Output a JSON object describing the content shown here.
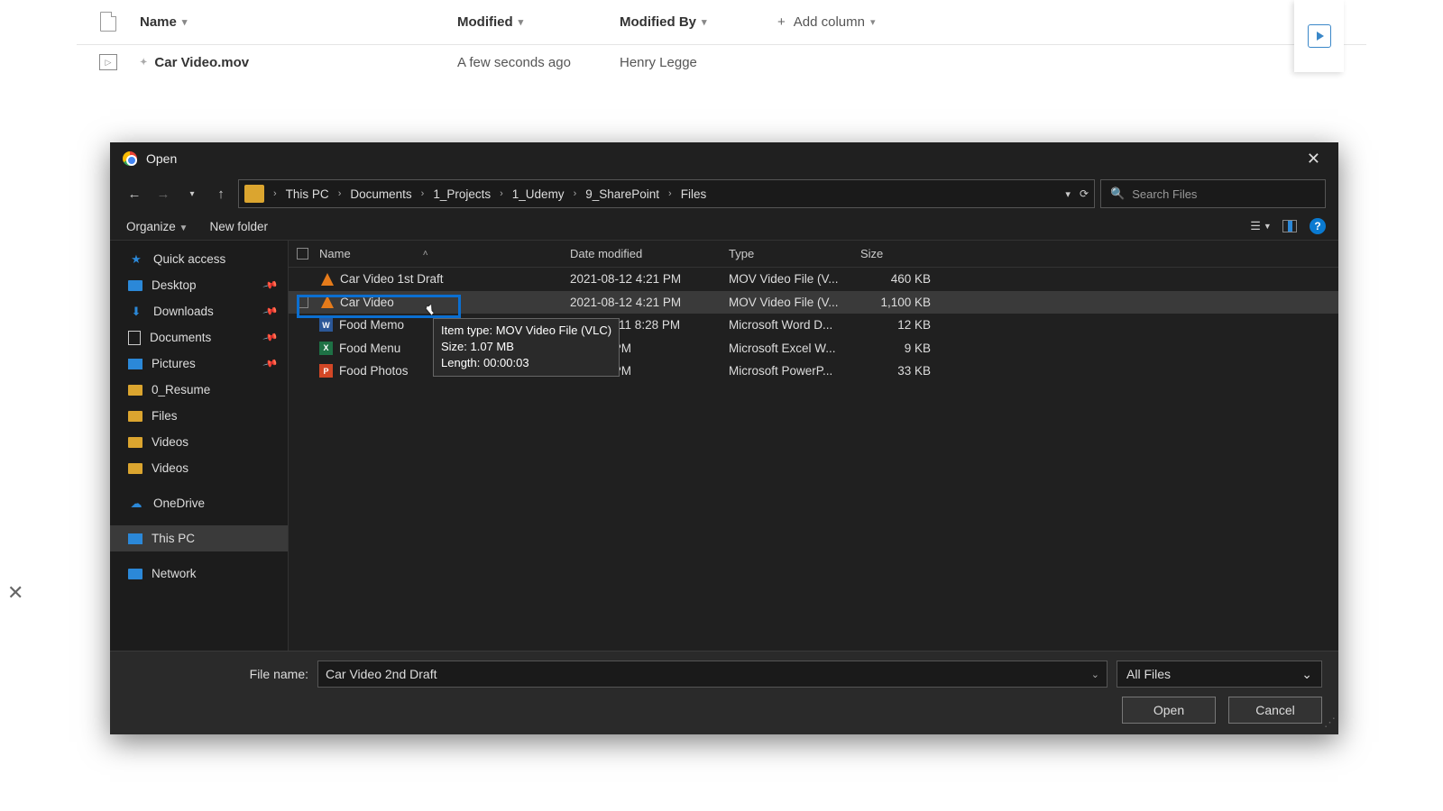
{
  "sp": {
    "cols": {
      "name": "Name",
      "modified": "Modified",
      "modby": "Modified By",
      "add": "Add column"
    },
    "row": {
      "name": "Car Video.mov",
      "modified": "A few seconds ago",
      "modby": "Henry Legge"
    }
  },
  "dlg": {
    "title": "Open",
    "crumbs": [
      "This PC",
      "Documents",
      "1_Projects",
      "1_Udemy",
      "9_SharePoint",
      "Files"
    ],
    "search_ph": "Search Files",
    "organize": "Organize",
    "newfolder": "New folder",
    "cols": {
      "name": "Name",
      "date": "Date modified",
      "type": "Type",
      "size": "Size"
    },
    "sidebar": {
      "quick": "Quick access",
      "desktop": "Desktop",
      "downloads": "Downloads",
      "documents": "Documents",
      "pictures": "Pictures",
      "resume": "0_Resume",
      "files": "Files",
      "videos1": "Videos",
      "videos2": "Videos",
      "onedrive": "OneDrive",
      "thispc": "This PC",
      "network": "Network"
    },
    "rows": [
      {
        "name": "Car Video 1st Draft",
        "icon": "vlc",
        "date": "2021-08-12 4:21 PM",
        "type": "MOV Video File (V...",
        "size": "460 KB"
      },
      {
        "name": "Car Video",
        "icon": "vlc",
        "date": "2021-08-12 4:21 PM",
        "type": "MOV Video File (V...",
        "size": "1,100 KB"
      },
      {
        "name": "Food Memo",
        "icon": "word",
        "date": "2021-08-11 8:28 PM",
        "type": "Microsoft Word D...",
        "size": "12 KB"
      },
      {
        "name": "Food Menu",
        "icon": "excel",
        "date": "11 8:29 PM",
        "type": "Microsoft Excel W...",
        "size": "9 KB"
      },
      {
        "name": "Food Photos",
        "icon": "ppt",
        "date": "11 8:29 PM",
        "type": "Microsoft PowerP...",
        "size": "33 KB"
      }
    ],
    "tooltip": {
      "l1": "Item type: MOV Video File (VLC)",
      "l2": "Size: 1.07 MB",
      "l3": "Length: 00:00:03"
    },
    "fn_label": "File name:",
    "fn_value": "Car Video 2nd Draft",
    "filter": "All Files",
    "open": "Open",
    "cancel": "Cancel"
  }
}
